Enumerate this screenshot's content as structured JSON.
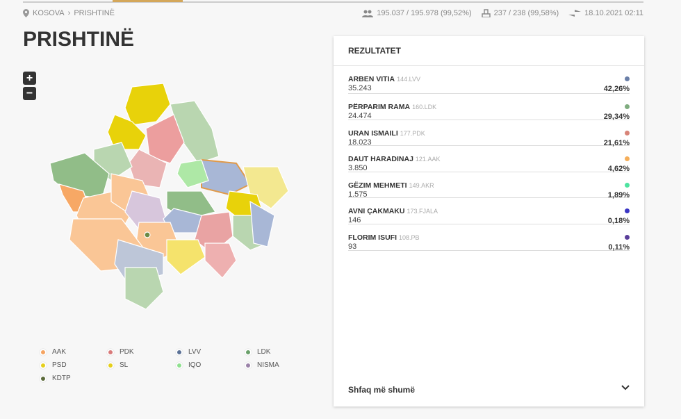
{
  "breadcrumb": [
    "KOSOVA",
    "PRISHTINË"
  ],
  "stats": {
    "voters": "195.037 / 195.978 (99,52%)",
    "stations": "237 / 238 (99,58%)",
    "updated": "18.10.2021 02:11"
  },
  "title": "PRISHTINË",
  "zoom": {
    "in": "+",
    "out": "−"
  },
  "legend": [
    {
      "label": "AAK",
      "color": "#f5a462"
    },
    {
      "label": "PDK",
      "color": "#d87a7a"
    },
    {
      "label": "LVV",
      "color": "#5b7196"
    },
    {
      "label": "LDK",
      "color": "#6aa06a"
    },
    {
      "label": "PSD",
      "color": "#e5cf1c"
    },
    {
      "label": "SL",
      "color": "#e5cf1c"
    },
    {
      "label": "IQO",
      "color": "#8fe08f"
    },
    {
      "label": "NISMA",
      "color": "#9a82a8"
    },
    {
      "label": "KDTP",
      "color": "#5b6a3a"
    }
  ],
  "results": {
    "title": "REZULTATET",
    "candidates": [
      {
        "name": "ARBEN VITIA",
        "party": "144.LVV",
        "votes": "35.243",
        "percent": "42,26%",
        "color": "#6a7fa8"
      },
      {
        "name": "PËRPARIM RAMA",
        "party": "160.LDK",
        "votes": "24.474",
        "percent": "29,34%",
        "color": "#7fac7f"
      },
      {
        "name": "URAN ISMAILI",
        "party": "177.PDK",
        "votes": "18.023",
        "percent": "21,61%",
        "color": "#d88478"
      },
      {
        "name": "DAUT HARADINAJ",
        "party": "121.AAK",
        "votes": "3.850",
        "percent": "4,62%",
        "color": "#f5ae5a"
      },
      {
        "name": "GËZIM MEHMETI",
        "party": "149.AKR",
        "votes": "1.575",
        "percent": "1,89%",
        "color": "#4ee3a0"
      },
      {
        "name": "AVNI ÇAKMAKU",
        "party": "173.FJALA",
        "votes": "146",
        "percent": "0,18%",
        "color": "#3a36c4"
      },
      {
        "name": "FLORIM ISUFI",
        "party": "108.PB",
        "votes": "93",
        "percent": "0,11%",
        "color": "#5a3e9a"
      }
    ],
    "show_more": "Shfaq më shumë"
  }
}
